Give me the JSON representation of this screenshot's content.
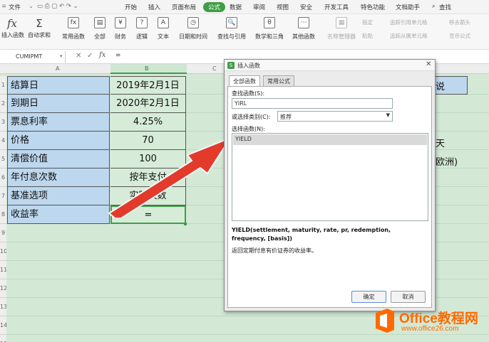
{
  "menu": [
    "文件",
    "开始",
    "插入",
    "页面布局",
    "公式",
    "数据",
    "审阅",
    "视图",
    "安全",
    "开发工具",
    "特色功能",
    "文档助手",
    "查找"
  ],
  "menu_active": "公式",
  "ribbon": {
    "buttons": [
      "插入函数",
      "自动求和",
      "常用函数",
      "全部",
      "财务",
      "逻辑",
      "文本",
      "日期和时间",
      "查找与引用",
      "数学和三角",
      "其他函数",
      "名称管理器"
    ],
    "small": [
      "指定",
      "粘贴",
      "追踪引用单元格",
      "追踪从属单元格",
      "移去箭头",
      "显示公式"
    ],
    "icon_glyphs": [
      "fx",
      "Σ",
      "fx",
      "▤",
      "¥",
      "?",
      "A",
      "◷",
      "🔍",
      "θ",
      "···",
      "▦"
    ]
  },
  "formula": {
    "name_box": "CUMIPMT",
    "value": "="
  },
  "columns": [
    "A",
    "B",
    "C"
  ],
  "rows": [
    {
      "num": "1",
      "label": "结算日",
      "value": "2019年2月1日"
    },
    {
      "num": "2",
      "label": "到期日",
      "value": "2020年2月1日"
    },
    {
      "num": "3",
      "label": "票息利率",
      "value": "4.25%"
    },
    {
      "num": "4",
      "label": "价格",
      "value": "70"
    },
    {
      "num": "5",
      "label": "清偿价值",
      "value": "100"
    },
    {
      "num": "6",
      "label": "年付息次数",
      "value": "按年支付"
    },
    {
      "num": "7",
      "label": "基准选项",
      "value": "实际天数"
    },
    {
      "num": "8",
      "label": "收益率",
      "value": "="
    }
  ],
  "row_nums_extra": [
    "9",
    "10",
    "11",
    "12",
    "13",
    "14",
    "15",
    "16",
    "17"
  ],
  "right_fragments": [
    "说",
    "天",
    "欧洲)"
  ],
  "dialog": {
    "title": "插入函数",
    "tabs": [
      "全部函数",
      "常用公式"
    ],
    "search_label": "查找函数(S):",
    "search_value": "YIRL",
    "category_label": "或选择类别(C):",
    "category_value": "推荐",
    "list_label": "选择函数(N):",
    "list_item": "YIELD",
    "signature": "YIELD(settlement, maturity, rate, pr, redemption, frequency, [basis])",
    "description": "返回定期付息有价证券的收益率。",
    "ok": "确定",
    "cancel": "取消"
  },
  "watermark": {
    "brand": "Office教程网",
    "url": "www.office26.com"
  },
  "colors": {
    "accent": "#3f9e47",
    "arrow": "#e23a2b",
    "labels_fill": "#bdd7ee",
    "values_fill": "#d6ecd8",
    "watermark": "#ff6a00"
  }
}
